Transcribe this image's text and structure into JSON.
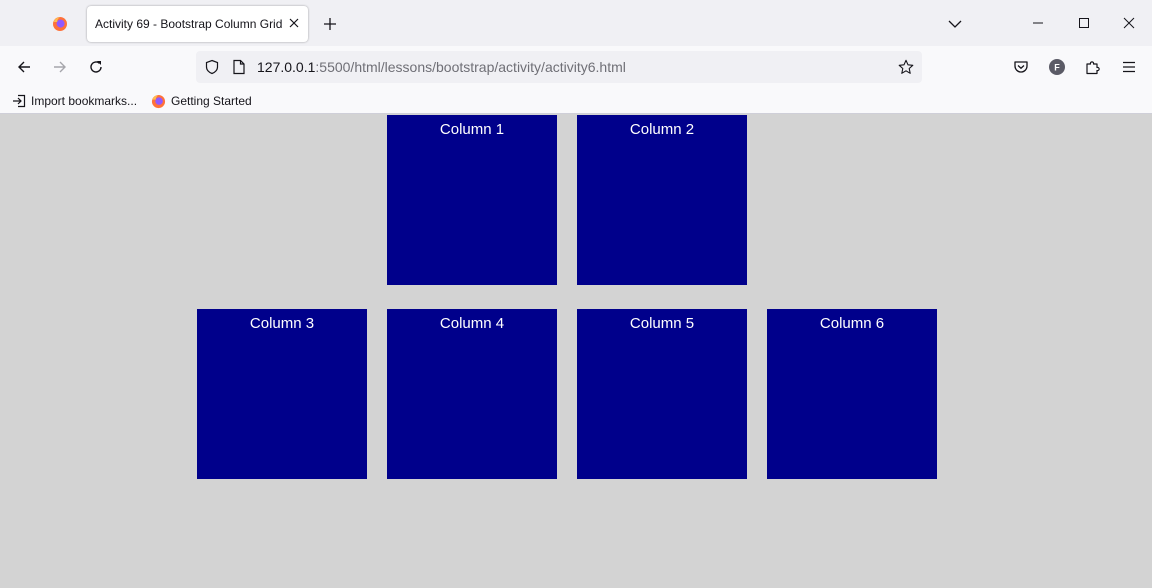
{
  "browser": {
    "tab": {
      "title": "Activity 69 - Bootstrap Column Grid"
    },
    "url": {
      "host": "127.0.0.1",
      "rest": ":5500/html/lessons/bootstrap/activity/activity6.html"
    },
    "profile_initial": "F",
    "bookmarks": [
      {
        "label": "Import bookmarks..."
      },
      {
        "label": "Getting Started"
      }
    ],
    "colors": {
      "tab_strip": "#f0f0f4",
      "toolbar": "#f9f9fb",
      "firefox_orange": "#ff7139",
      "firefox_purple": "#9059ff"
    }
  },
  "page": {
    "background": "#d3d3d3",
    "box_color": "#00008b",
    "rows": [
      {
        "columns": [
          {
            "label": "Column 1"
          },
          {
            "label": "Column 2"
          }
        ]
      },
      {
        "columns": [
          {
            "label": "Column 3"
          },
          {
            "label": "Column 4"
          },
          {
            "label": "Column 5"
          },
          {
            "label": "Column 6"
          }
        ]
      }
    ]
  }
}
